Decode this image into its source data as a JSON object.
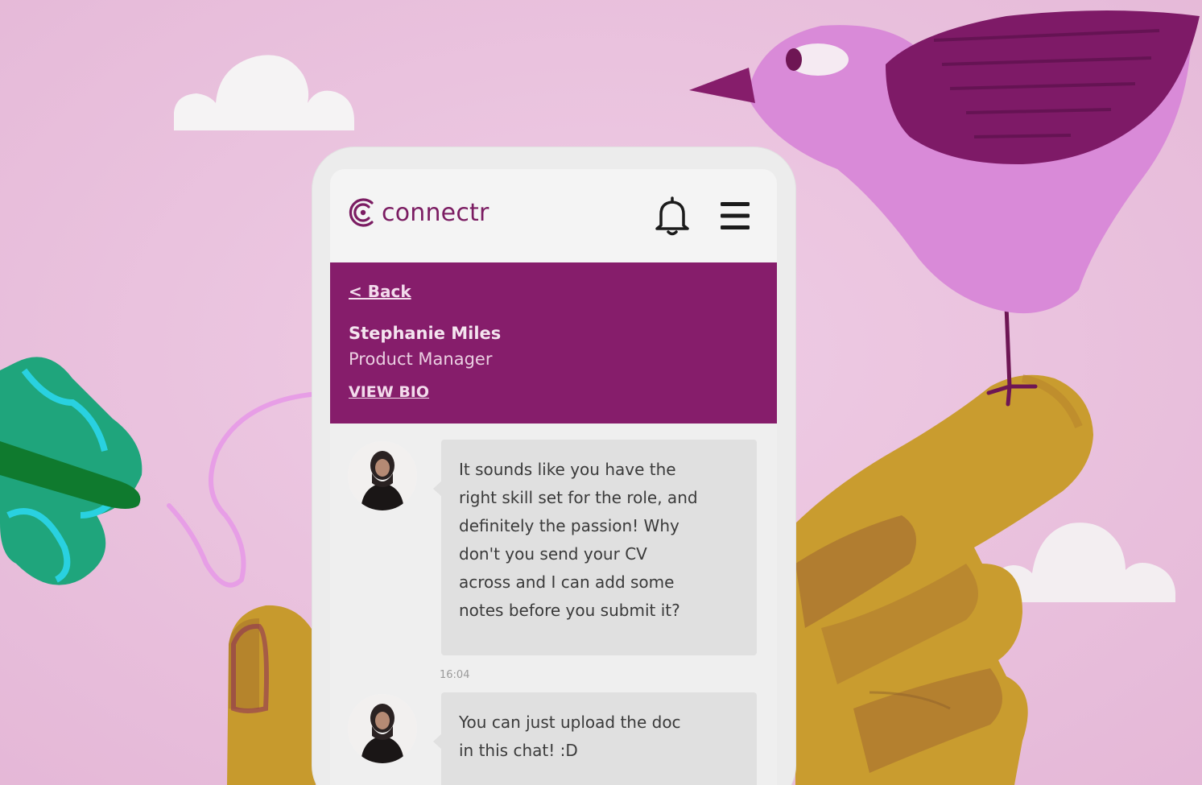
{
  "app": {
    "logo_text": "connectr",
    "brand_color": "#861d6b",
    "icons": [
      "connectr-logo-icon",
      "bell-icon",
      "hamburger-menu-icon"
    ]
  },
  "profile": {
    "back_label": "< Back",
    "name": "Stephanie Miles",
    "role": "Product Manager",
    "view_bio_label": "VIEW BIO"
  },
  "messages": [
    {
      "text": "It sounds like you have the\nright skill set for the role, and\ndefinitely the passion! Why\ndon't you send your CV\nacross and I can add some\nnotes before you submit it?",
      "time": "16:04"
    },
    {
      "text": "You can just upload the doc\nin this chat! :D"
    }
  ]
}
